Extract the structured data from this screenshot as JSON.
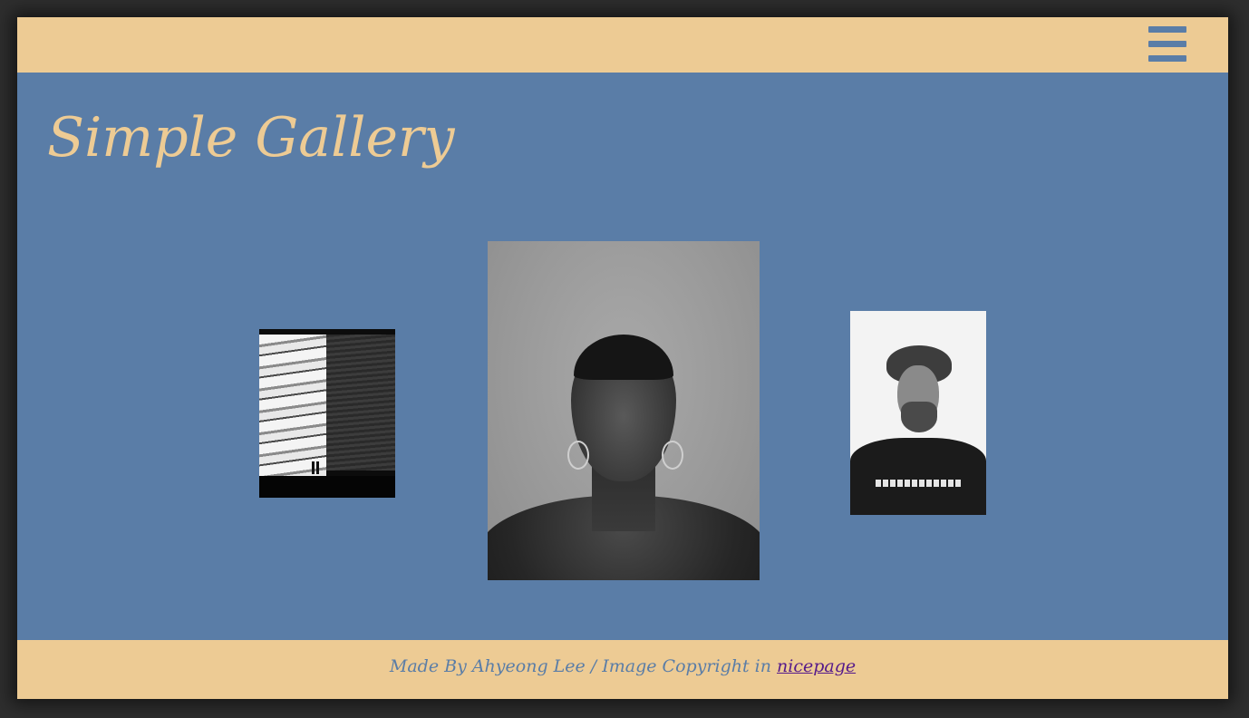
{
  "header": {
    "menu_icon": "hamburger-menu-icon"
  },
  "title": "Simple Gallery",
  "gallery": {
    "photos": [
      {
        "subject": "black-and-white-architecture-photo"
      },
      {
        "subject": "black-and-white-woman-portrait"
      },
      {
        "subject": "black-and-white-curly-haired-man-portrait"
      }
    ]
  },
  "footer": {
    "credit": "Made By Ahyeong Lee / Image Copyright in ",
    "link_text": "nicepage"
  },
  "colors": {
    "bar": "#edcb94",
    "background": "#5a7da7",
    "link": "#551a8b"
  }
}
